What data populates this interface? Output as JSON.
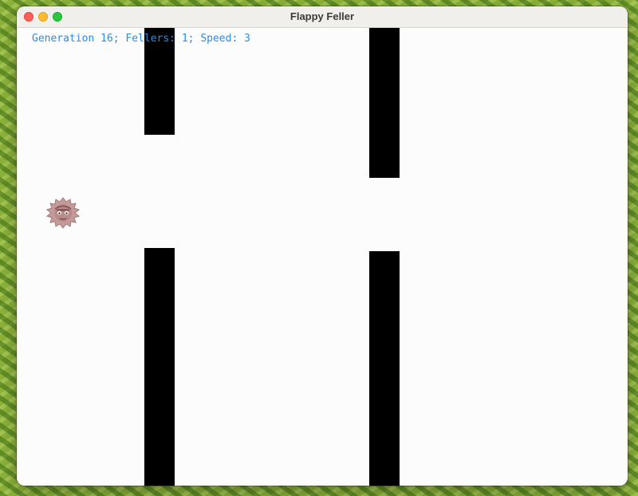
{
  "window": {
    "title": "Flappy Feller"
  },
  "hud": {
    "text": "Generation 16; Fellers: 1; Speed: 3"
  },
  "sprites": {
    "feller": "feller-character"
  },
  "colors": {
    "background": "#8db33a",
    "canvas": "#fcfcfc",
    "pipe": "#000000",
    "hud_text": "#2b8ce6",
    "feller": "#c49a9a"
  }
}
